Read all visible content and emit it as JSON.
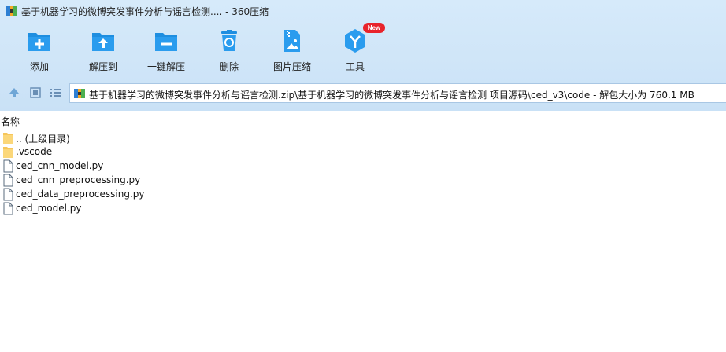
{
  "window": {
    "title": "基于机器学习的微博突发事件分析与谣言检测.... - 360压缩"
  },
  "toolbar": {
    "items": [
      {
        "label": "添加",
        "icon": "add-folder-icon"
      },
      {
        "label": "解压到",
        "icon": "extract-to-icon"
      },
      {
        "label": "一键解压",
        "icon": "one-click-extract-icon"
      },
      {
        "label": "删除",
        "icon": "recycle-bin-icon"
      },
      {
        "label": "图片压缩",
        "icon": "image-compress-icon"
      },
      {
        "label": "工具",
        "icon": "tools-icon",
        "badge": "New"
      }
    ],
    "colors": {
      "icon_blue": "#1e8ee0",
      "badge_red": "#e8232b"
    }
  },
  "nav": {
    "path": "基于机器学习的微博突发事件分析与谣言检测.zip\\基于机器学习的微博突发事件分析与谣言检测 项目源码\\ced_v3\\code - 解包大小为 760.1 MB"
  },
  "list": {
    "column_name": "名称",
    "items": [
      {
        "name": ".. (上级目录)",
        "type": "folder"
      },
      {
        "name": ".vscode",
        "type": "folder"
      },
      {
        "name": "ced_cnn_model.py",
        "type": "file"
      },
      {
        "name": "ced_cnn_preprocessing.py",
        "type": "file"
      },
      {
        "name": "ced_data_preprocessing.py",
        "type": "file"
      },
      {
        "name": "ced_model.py",
        "type": "file"
      }
    ]
  }
}
